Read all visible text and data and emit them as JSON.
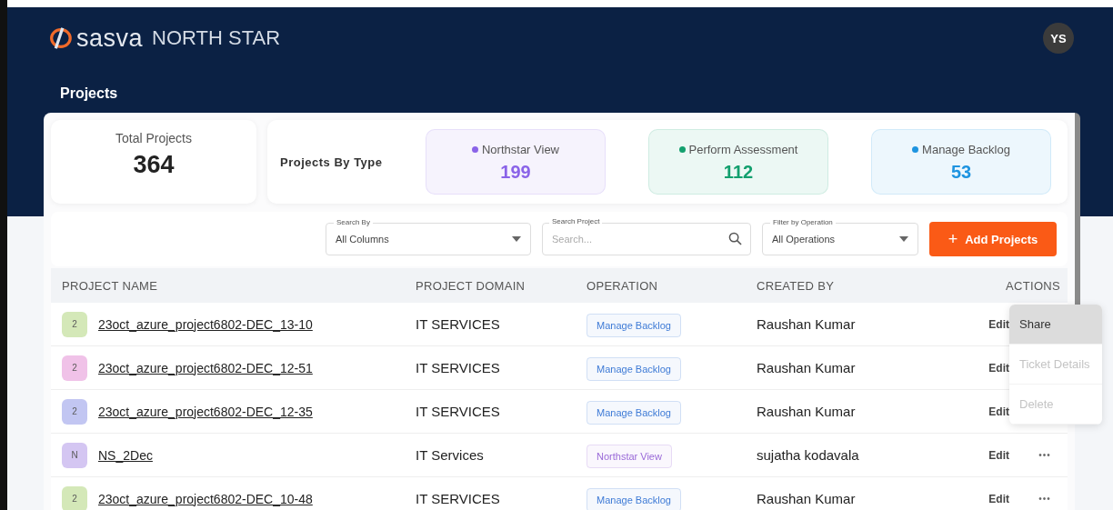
{
  "header": {
    "brand": "sasva",
    "product": "NORTH STAR",
    "avatar": "YS"
  },
  "page_title": "Projects",
  "total": {
    "label": "Total Projects",
    "value": "364"
  },
  "by_type": {
    "label": "Projects By Type",
    "types": [
      {
        "label": "Northstar View",
        "value": "199",
        "color": "#8a63e8"
      },
      {
        "label": "Perform Assessment",
        "value": "112",
        "color": "#13a06e"
      },
      {
        "label": "Manage Backlog",
        "value": "53",
        "color": "#1e94e0"
      }
    ]
  },
  "filters": [
    {
      "kind": "select",
      "label": "Search By",
      "value": "All Columns"
    },
    {
      "kind": "search",
      "label": "Search Project",
      "placeholder": "Search..."
    },
    {
      "kind": "select",
      "label": "Filter by Operation",
      "value": "All Operations"
    }
  ],
  "add_button": {
    "icon": "+",
    "label": "Add Projects"
  },
  "table": {
    "columns": [
      "PROJECT NAME",
      "PROJECT DOMAIN",
      "OPERATION",
      "CREATED BY",
      "ACTIONS"
    ],
    "rows": [
      {
        "initial": "2",
        "color": "#d4e8b8",
        "name": "23oct_azure_project6802-DEC_13-10",
        "domain": "IT SERVICES",
        "operation": {
          "label": "Manage Backlog",
          "color": "#3f7bd6"
        },
        "created_by": "Raushan Kumar",
        "edit": "Edit"
      },
      {
        "initial": "2",
        "color": "#f0c2e8",
        "name": "23oct_azure_project6802-DEC_12-51",
        "domain": "IT SERVICES",
        "operation": {
          "label": "Manage Backlog",
          "color": "#3f7bd6"
        },
        "created_by": "Raushan Kumar",
        "edit": "Edit"
      },
      {
        "initial": "2",
        "color": "#c2c6f2",
        "name": "23oct_azure_project6802-DEC_12-35",
        "domain": "IT SERVICES",
        "operation": {
          "label": "Manage Backlog",
          "color": "#3f7bd6"
        },
        "created_by": "Raushan Kumar",
        "edit": "Edit"
      },
      {
        "initial": "N",
        "color": "#d4c6f2",
        "name": "NS_2Dec",
        "domain": "IT Services",
        "operation": {
          "label": "Northstar View",
          "color": "#9a6ad8"
        },
        "created_by": "sujatha kodavala",
        "edit": "Edit",
        "more": "•••"
      },
      {
        "initial": "2",
        "color": "#d4e8b8",
        "name": "23oct_azure_project6802-DEC_10-48",
        "domain": "IT SERVICES",
        "operation": {
          "label": "Manage Backlog",
          "color": "#3f7bd6"
        },
        "created_by": "Raushan Kumar",
        "edit": "Edit",
        "more": "•••"
      }
    ]
  },
  "row_menu": [
    {
      "label": "Share",
      "highlighted": true,
      "disabled": false
    },
    {
      "label": "Ticket Details",
      "highlighted": false,
      "disabled": true
    },
    {
      "label": "Delete",
      "highlighted": false,
      "disabled": true
    }
  ]
}
